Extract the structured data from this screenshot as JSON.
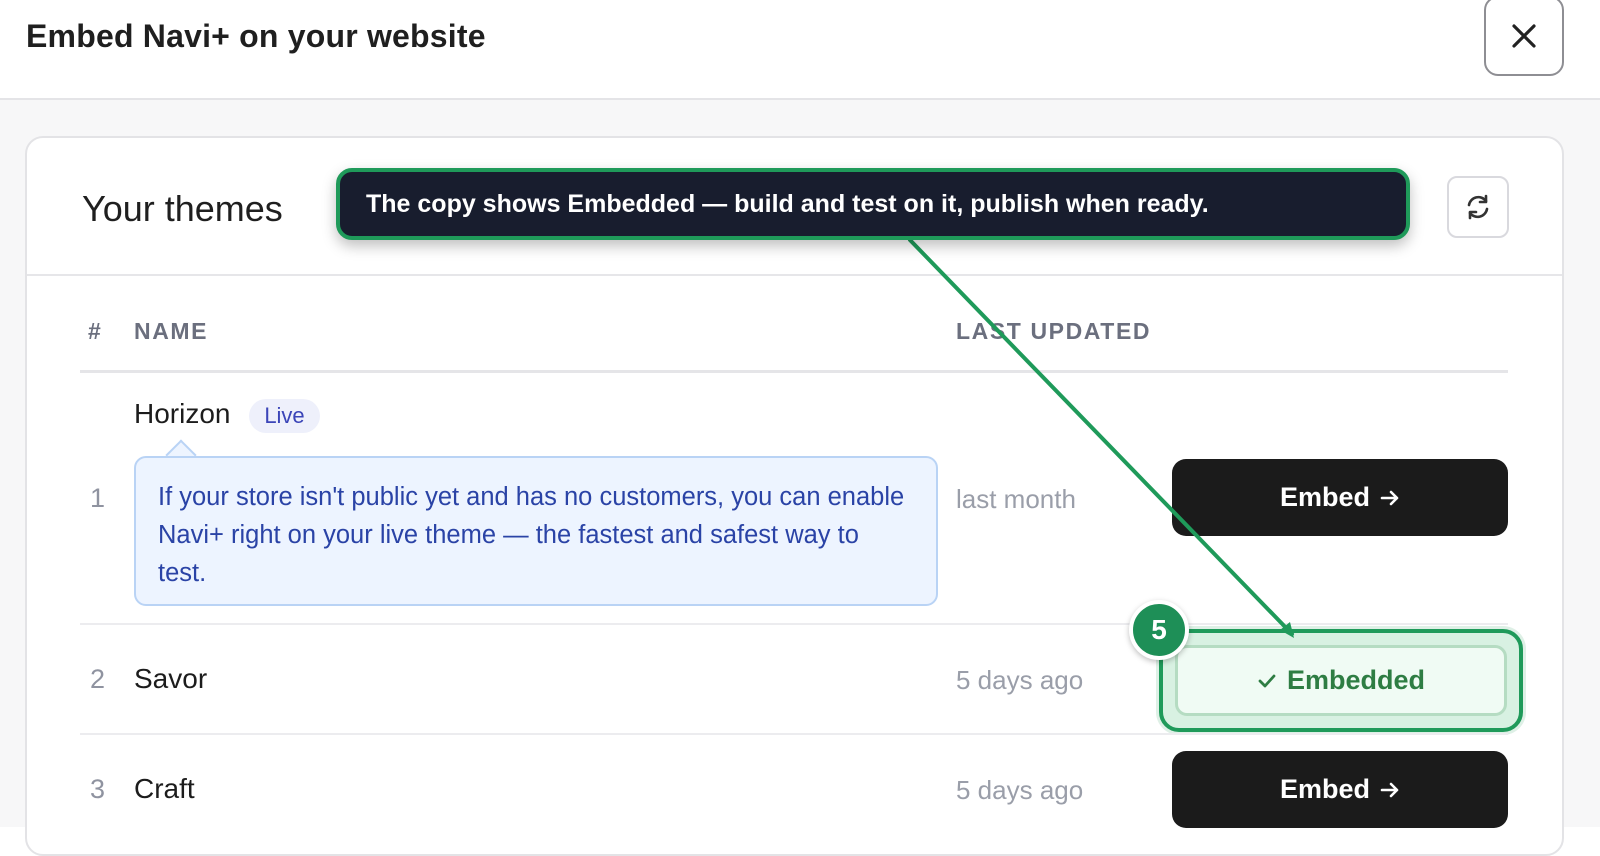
{
  "dialog": {
    "title": "Embed Navi+ on your website",
    "close_icon": "close-icon"
  },
  "themes_card": {
    "title": "Your themes",
    "refresh_icon": "refresh-icon",
    "columns": {
      "number": "#",
      "name": "NAME",
      "last_updated": "LAST UPDATED"
    },
    "rows": [
      {
        "number": "1",
        "name": "Horizon",
        "badge": "Live",
        "info": "If your store isn't public yet and has no customers, you can enable Navi+ right on your live theme — the fastest and safest way to test.",
        "last_updated": "last month",
        "action": "Embed",
        "action_icon": "arrow-right-icon"
      },
      {
        "number": "2",
        "name": "Savor",
        "last_updated": "5 days ago",
        "action": "Embedded",
        "action_icon": "check-icon"
      },
      {
        "number": "3",
        "name": "Craft",
        "last_updated": "5 days ago",
        "action": "Embed",
        "action_icon": "arrow-right-icon"
      }
    ]
  },
  "guide": {
    "step_number": "5",
    "tooltip": "The copy shows Embedded — build and test on it, publish when ready.",
    "accent_color": "#1f9a5a",
    "tooltip_bg": "#181d2e"
  }
}
